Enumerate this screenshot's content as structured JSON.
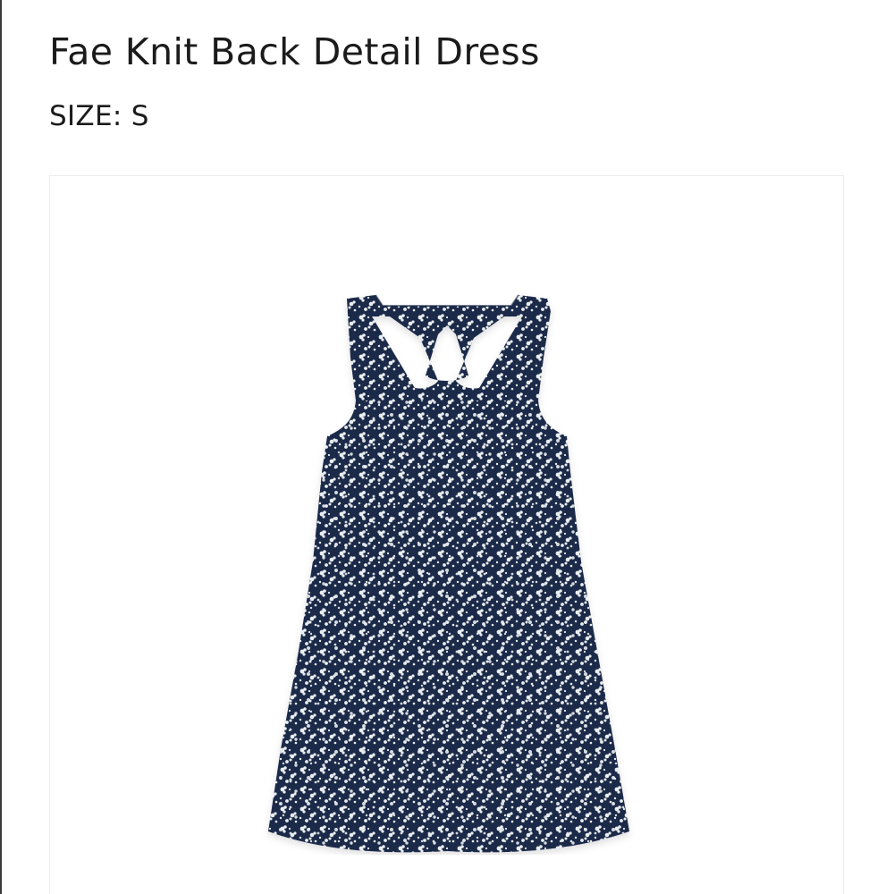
{
  "product": {
    "title": "Fae Knit Back Detail Dress",
    "size_label": "SIZE:",
    "size_value": "S"
  },
  "image": {
    "subject": "dress-image",
    "colors": {
      "base": "#1e2a4a",
      "print": "#e9eef0",
      "border": "#ececec"
    }
  }
}
